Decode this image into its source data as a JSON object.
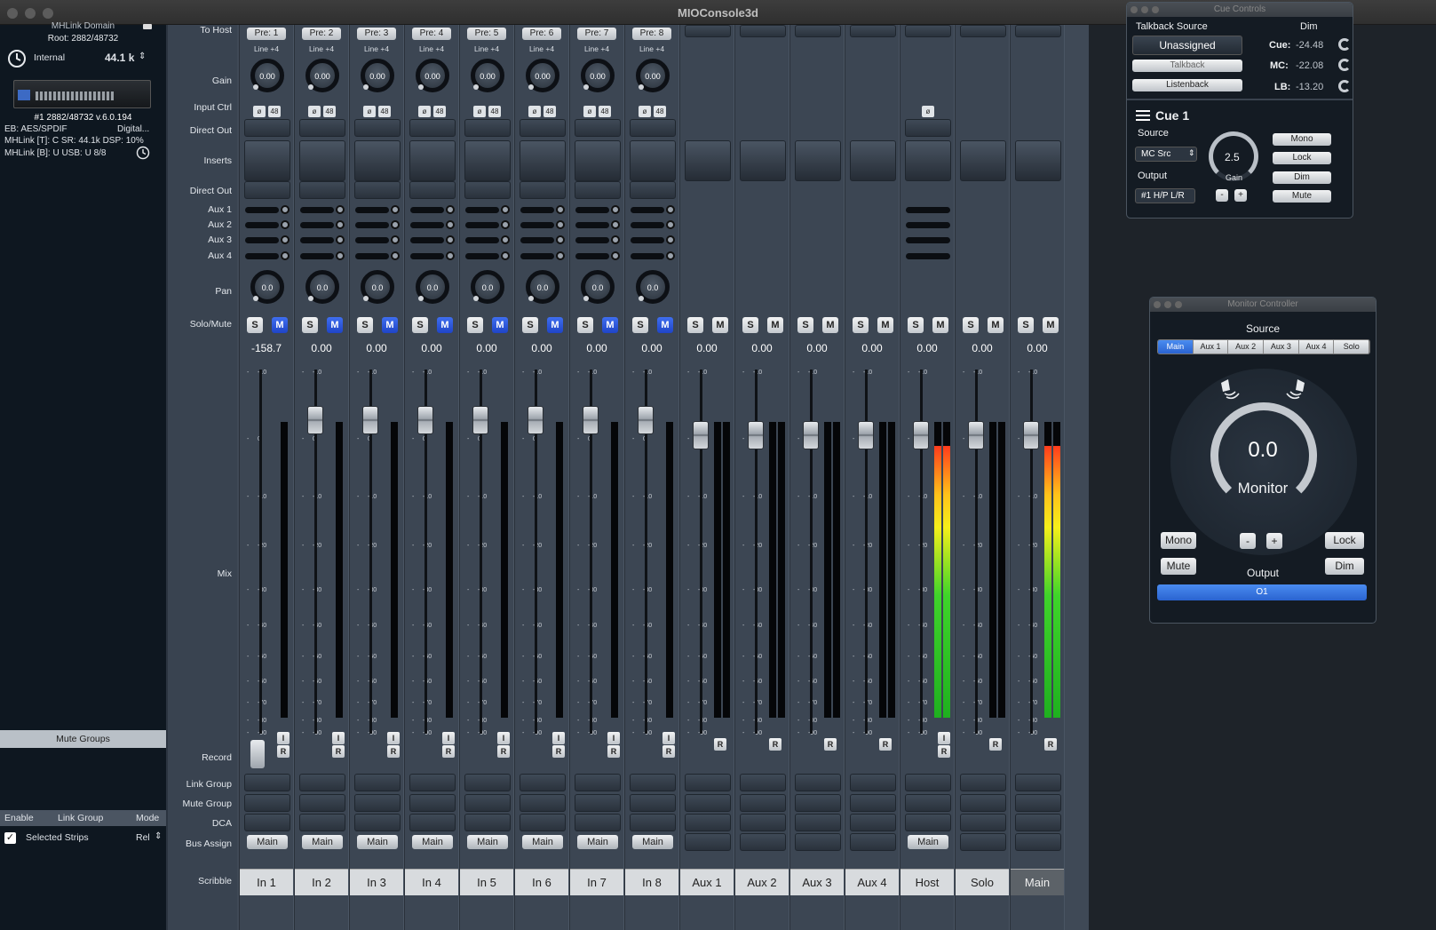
{
  "window": {
    "title": "MIOConsole3d"
  },
  "sidebar": {
    "domain_label": "MHLink Domain",
    "root": "Root: 2882/48732",
    "clock_source": "Internal",
    "sample_rate": "44.1 k",
    "device_id": "#1 2882/48732 v.6.0.194",
    "eb_label": "EB: AES/SPDIF",
    "eb_value": "Digital...",
    "mhlink_t": "MHLink [T]: C SR: 44.1k DSP: 10%",
    "mhlink_b": "MHLink [B]: U USB: U 8/8",
    "mute_groups_header": "Mute Groups",
    "groups_columns": [
      "Enable",
      "Link Group",
      "Mode"
    ],
    "selected_strips_label": "Selected Strips",
    "mode_value": "Rel",
    "selected_checked": true
  },
  "row_labels": {
    "to_host": "To Host",
    "gain": "Gain",
    "input_ctrl": "Input Ctrl",
    "direct_out_1": "Direct Out",
    "inserts": "Inserts",
    "direct_out_2": "Direct Out",
    "aux1": "Aux 1",
    "aux2": "Aux 2",
    "aux3": "Aux 3",
    "aux4": "Aux 4",
    "pan": "Pan",
    "solo_mute": "Solo/Mute",
    "mix": "Mix",
    "record": "Record",
    "link_group": "Link Group",
    "mute_group": "Mute Group",
    "dca": "DCA",
    "bus_assign": "Bus Assign",
    "scribble": "Scribble"
  },
  "fader_scale": [
    "-10",
    "0",
    "-10",
    "-20",
    "-30",
    "-40",
    "-50",
    "-60",
    "-70",
    "-80",
    "-90"
  ],
  "input_strips": [
    {
      "pre": "Pre: 1",
      "sub": "Line +4",
      "gain": "0.00",
      "pan": "0.0",
      "fader": "-158.7",
      "bus": "Main",
      "name": "In 1",
      "fader_level": 0.0
    },
    {
      "pre": "Pre: 2",
      "sub": "Line +4",
      "gain": "0.00",
      "pan": "0.0",
      "fader": "0.00",
      "bus": "Main",
      "name": "In 2",
      "fader_level": 0.86
    },
    {
      "pre": "Pre: 3",
      "sub": "Line +4",
      "gain": "0.00",
      "pan": "0.0",
      "fader": "0.00",
      "bus": "Main",
      "name": "In 3",
      "fader_level": 0.86
    },
    {
      "pre": "Pre: 4",
      "sub": "Line +4",
      "gain": "0.00",
      "pan": "0.0",
      "fader": "0.00",
      "bus": "Main",
      "name": "In 4",
      "fader_level": 0.86
    },
    {
      "pre": "Pre: 5",
      "sub": "Line +4",
      "gain": "0.00",
      "pan": "0.0",
      "fader": "0.00",
      "bus": "Main",
      "name": "In 5",
      "fader_level": 0.86
    },
    {
      "pre": "Pre: 6",
      "sub": "Line +4",
      "gain": "0.00",
      "pan": "0.0",
      "fader": "0.00",
      "bus": "Main",
      "name": "In 6",
      "fader_level": 0.86
    },
    {
      "pre": "Pre: 7",
      "sub": "Line +4",
      "gain": "0.00",
      "pan": "0.0",
      "fader": "0.00",
      "bus": "Main",
      "name": "In 7",
      "fader_level": 0.86
    },
    {
      "pre": "Pre: 8",
      "sub": "Line +4",
      "gain": "0.00",
      "pan": "0.0",
      "fader": "0.00",
      "bus": "Main",
      "name": "In 8",
      "fader_level": 0.86
    }
  ],
  "output_strips": [
    {
      "fader": "0.00",
      "name": "Aux 1",
      "bus": "",
      "meter_level": 0.0
    },
    {
      "fader": "0.00",
      "name": "Aux 2",
      "bus": "",
      "meter_level": 0.0
    },
    {
      "fader": "0.00",
      "name": "Aux 3",
      "bus": "",
      "meter_level": 0.0
    },
    {
      "fader": "0.00",
      "name": "Aux 4",
      "bus": "",
      "meter_level": 0.0
    },
    {
      "fader": "0.00",
      "name": "Host",
      "bus": "Main",
      "meter_level": 0.92
    },
    {
      "fader": "0.00",
      "name": "Solo",
      "bus": "",
      "meter_level": 0.0
    },
    {
      "fader": "0.00",
      "name": "Main",
      "bus": "",
      "meter_level": 0.92
    }
  ],
  "buttons": {
    "solo": "S",
    "mute": "M",
    "phase": "ø",
    "p48": "48",
    "input": "I",
    "record": "R"
  },
  "cue_controls": {
    "title": "Cue Controls",
    "talkback_source_label": "Talkback Source",
    "talkback_source_value": "Unassigned",
    "dim_label": "Dim",
    "talkback_btn": "Talkback",
    "listenback_btn": "Listenback",
    "cue_label": "Cue:",
    "cue_value": "-24.48",
    "mc_label": "MC:",
    "mc_value": "-22.08",
    "lb_label": "LB:",
    "lb_value": "-13.20",
    "cue_name": "Cue 1",
    "source_label": "Source",
    "source_value": "MC Src",
    "output_label": "Output",
    "output_value": "#1 H/P L/R",
    "gain_value": "2.5",
    "gain_label": "Gain",
    "minus": "-",
    "plus": "+",
    "mono": "Mono",
    "lock": "Lock",
    "dim": "Dim",
    "mute": "Mute"
  },
  "monitor_controller": {
    "title": "Monitor Controller",
    "source_label": "Source",
    "source_tabs": [
      "Main",
      "Aux 1",
      "Aux 2",
      "Aux 3",
      "Aux 4",
      "Solo"
    ],
    "active_tab": "Main",
    "value": "0.0",
    "knob_label": "Monitor",
    "mono": "Mono",
    "mute": "Mute",
    "minus": "-",
    "plus": "+",
    "lock": "Lock",
    "dim": "Dim",
    "output_label": "Output",
    "output_value": "O1"
  }
}
